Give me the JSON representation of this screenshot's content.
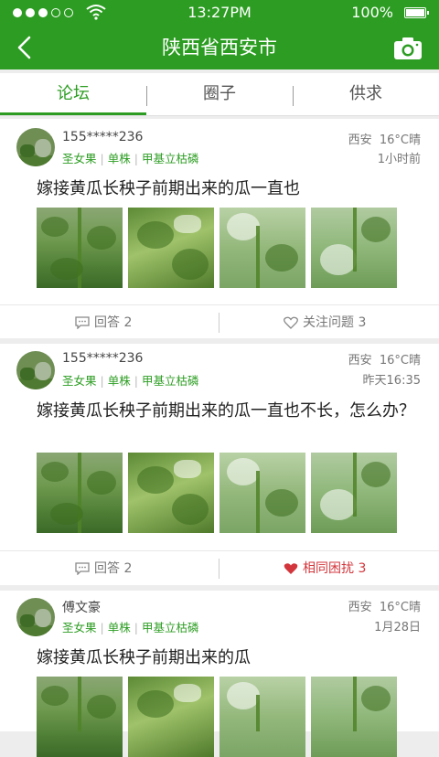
{
  "status_bar": {
    "time": "13:27PM",
    "battery": "100%"
  },
  "navbar": {
    "title": "陕西省西安市"
  },
  "tabs": [
    {
      "label": "论坛",
      "active": true
    },
    {
      "label": "圈子",
      "active": false
    },
    {
      "label": "供求",
      "active": false
    }
  ],
  "colors": {
    "brand_green": "#2c9d22",
    "tag_green": "#2c9d22",
    "alert_red": "#d2363c"
  },
  "posts": [
    {
      "user": "155*****236",
      "tags": [
        "圣女果",
        "单株",
        "甲基立枯磷"
      ],
      "location": "西安",
      "weather": "16°C晴",
      "time": "1小时前",
      "content": "嫁接黄瓜长秧子前期出来的瓜一直也",
      "replies": "回答 2",
      "follow": "关注问题 3"
    },
    {
      "user": "155*****236",
      "tags": [
        "圣女果",
        "单株",
        "甲基立枯磷"
      ],
      "location": "西安",
      "weather": "16°C晴",
      "time": "昨天16:35",
      "content": "嫁接黄瓜长秧子前期出来的瓜一直也不长，怎么办？",
      "replies": "回答 2",
      "follow": "相同困扰 3"
    },
    {
      "user": "傅文豪",
      "tags": [
        "圣女果",
        "单株",
        "甲基立枯磷"
      ],
      "location": "西安",
      "weather": "16°C晴",
      "time": "1月28日",
      "content": "嫁接黄瓜长秧子前期出来的瓜"
    }
  ]
}
